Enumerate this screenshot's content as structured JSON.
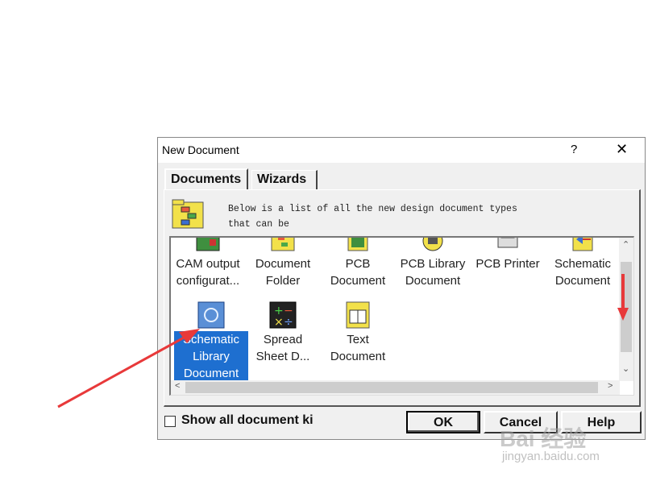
{
  "dialog": {
    "title": "New Document",
    "help_glyph": "?",
    "close_glyph": "✕"
  },
  "tabs": [
    {
      "label": "Documents",
      "selected": true
    },
    {
      "label": "Wizards",
      "selected": false
    }
  ],
  "description": {
    "line1": "Below is a list of all the new design document types",
    "line2": "that can be"
  },
  "documents": [
    {
      "line1": "CAM output",
      "line2": "configurat...",
      "icon": "cam-icon"
    },
    {
      "line1": "Document",
      "line2": "Folder",
      "icon": "folder-icon"
    },
    {
      "line1": "PCB",
      "line2": "Document",
      "icon": "pcb-icon"
    },
    {
      "line1": "PCB Library",
      "line2": "Document",
      "icon": "pcb-library-icon"
    },
    {
      "line1": "PCB Printer",
      "line2": "",
      "icon": "printer-icon"
    },
    {
      "line1": "Schematic",
      "line2": "Document",
      "icon": "schematic-icon"
    },
    {
      "line1": "Schematic",
      "line2": "Library",
      "line3": "Document",
      "icon": "schematic-library-icon",
      "selected": true
    },
    {
      "line1": "Spread",
      "line2": "Sheet D...",
      "icon": "spreadsheet-icon"
    },
    {
      "line1": "Text",
      "line2": "Document",
      "icon": "text-document-icon"
    }
  ],
  "checkbox": {
    "label": "Show all document ki",
    "checked": false
  },
  "buttons": {
    "ok": "OK",
    "cancel": "Cancel",
    "help": "Help"
  },
  "scroll_glyphs": {
    "up": "⌃",
    "down": "⌄",
    "left": "<",
    "right": ">"
  },
  "watermark": {
    "brand": "Bai  经验",
    "url": "jingyan.baidu.com"
  },
  "colors": {
    "selection": "#1e6fd0",
    "annotation_arrow": "#e8393a"
  }
}
